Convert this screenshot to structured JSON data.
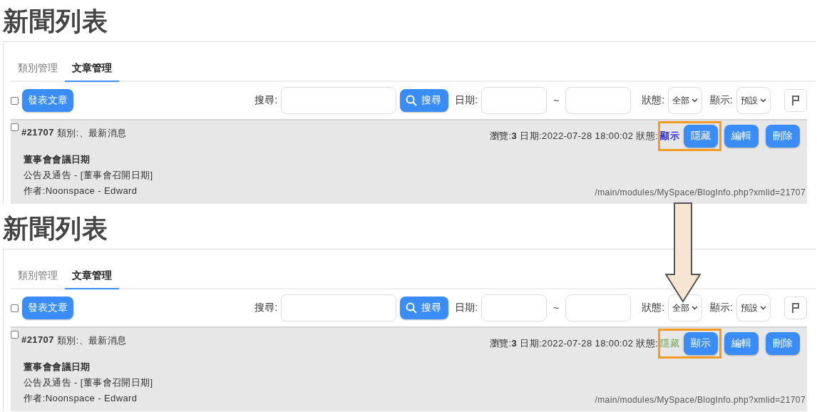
{
  "panels": [
    {
      "title": "新聞列表",
      "tabs": [
        {
          "label": "類別管理",
          "selected": false
        },
        {
          "label": "文章管理",
          "selected": true
        }
      ],
      "toolbar": {
        "select_all_checked": false,
        "post_button": "發表文章",
        "search_label": "搜尋:",
        "search_button": "搜尋",
        "date_label": "日期:",
        "date_separator": "~",
        "status_label": "狀態:",
        "status_filter": "全部",
        "display_label": "顯示:",
        "display_filter": "預設"
      },
      "article": {
        "checked": false,
        "id": "#21707",
        "category": "類別:、最新消息",
        "stats": "瀏覽:**3** 日期:2022-07-28 18:00:02 狀態:",
        "status": "顯示",
        "status_visible": true,
        "highlighted": true,
        "buttons": [
          "隱藏",
          "編輯",
          "刪除"
        ],
        "title": "董事會會議日期",
        "summary": "公告及通告 - [董事會召開日期]",
        "author": "作者:Noonspace - Edward",
        "url": "/main/modules/MySpace/BlogInfo.php?xmlid=21707"
      }
    },
    {
      "title": "新聞列表",
      "tabs": [
        {
          "label": "類別管理",
          "selected": false
        },
        {
          "label": "文章管理",
          "selected": true
        }
      ],
      "toolbar": {
        "select_all_checked": false,
        "post_button": "發表文章",
        "search_label": "搜尋:",
        "search_button": "搜尋",
        "date_label": "日期:",
        "date_separator": "~",
        "status_label": "狀態:",
        "status_filter": "全部",
        "display_label": "顯示:",
        "display_filter": "預設"
      },
      "article": {
        "checked": false,
        "id": "#21707",
        "category": "類別:、最新消息",
        "stats": "瀏覽:**3** 日期:2022-07-28 18:00:02 狀態:",
        "status": "隱藏",
        "status_visible": false,
        "highlighted": true,
        "buttons": [
          "顯示",
          "編輯",
          "刪除"
        ],
        "title": "董事會會議日期",
        "summary": "公告及通告 - [董事會召開日期]",
        "author": "作者:Noonspace - Edward",
        "url": "/main/modules/MySpace/BlogInfo.php?xmlid=21707"
      }
    }
  ],
  "arrow": {
    "kind": "down"
  }
}
